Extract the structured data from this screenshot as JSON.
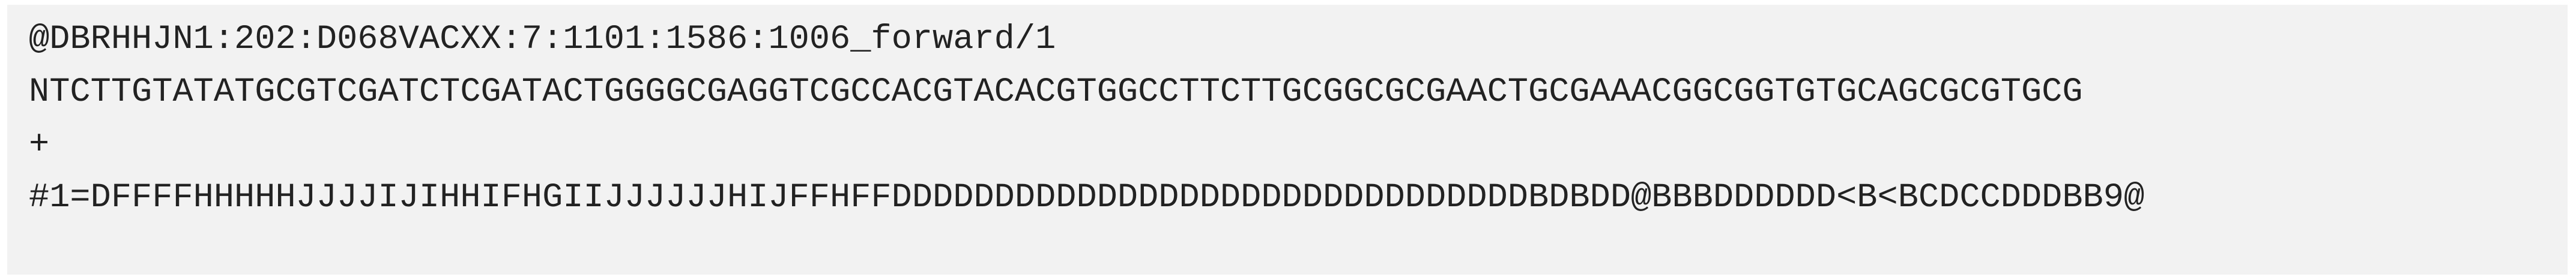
{
  "fastq_record": {
    "header": "@DBRHHJN1:202:D068VACXX:7:1101:1586:1006_forward/1",
    "sequence": "NTCTTGTATATGCGTCGATCTCGATACTGGGGCGAGGTCGCCACGTACACGTGGCCTTCTTGCGGCGCGAACTGCGAAACGGCGGTGTGCAGCGCGTGCG",
    "separator": "+",
    "quality": "#1=DFFFFHHHHHJJJJIJIHHIFHGIIJJJJJJHIJFFHFFDDDDDDDDDDDDDDDDDDDDDDDDDDDDDDDBDBDD@BBBDDDDDD<B<BCDCCDDDBB9@"
  },
  "colors": {
    "block_background": "#f2f2f2",
    "text": "#222222"
  }
}
